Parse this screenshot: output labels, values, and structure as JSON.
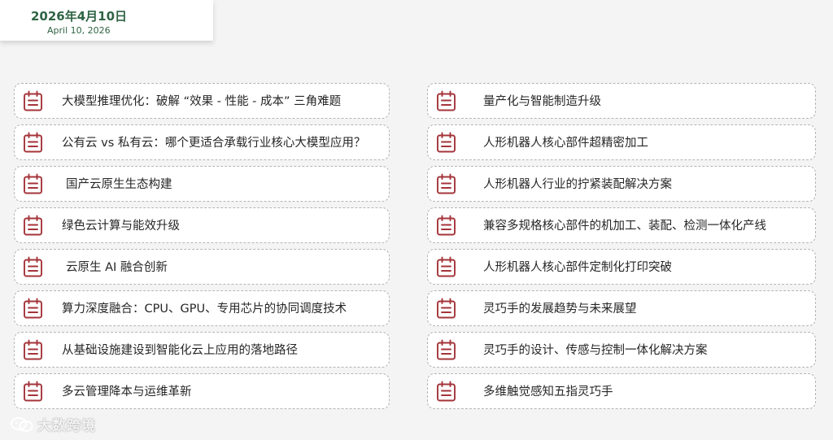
{
  "header": {
    "date_cn": "2026年4月10日",
    "date_en": "April 10, 2026"
  },
  "icon": {
    "name": "calendar-list-icon",
    "color": "#a4343a"
  },
  "left_items": [
    {
      "label": "大模型推理优化：破解 “效果 - 性能 - 成本” 三角难题"
    },
    {
      "label": "公有云 vs 私有云：哪个更适合承载行业核心大模型应用？"
    },
    {
      "label": "国产云原生生态构建"
    },
    {
      "label": "绿色云计算与能效升级"
    },
    {
      "label": "云原生 AI 融合创新"
    },
    {
      "label": "算力深度融合：CPU、GPU、专用芯片的协同调度技术"
    },
    {
      "label": "从基础设施建设到智能化云上应用的落地路径"
    },
    {
      "label": "多云管理降本与运维革新"
    }
  ],
  "right_items": [
    {
      "label": "量产化与智能制造升级"
    },
    {
      "label": "人形机器人核心部件超精密加工"
    },
    {
      "label": "人形机器人行业的拧紧装配解决方案"
    },
    {
      "label": "兼容多规格核心部件的机加工、装配、检测一体化产线"
    },
    {
      "label": "人形机器人核心部件定制化打印突破"
    },
    {
      "label": "灵巧手的发展趋势与未来展望"
    },
    {
      "label": "灵巧手的设计、传感与控制一体化解决方案"
    },
    {
      "label": "多维触觉感知五指灵巧手"
    }
  ],
  "watermark": {
    "text": "大数跨境"
  }
}
